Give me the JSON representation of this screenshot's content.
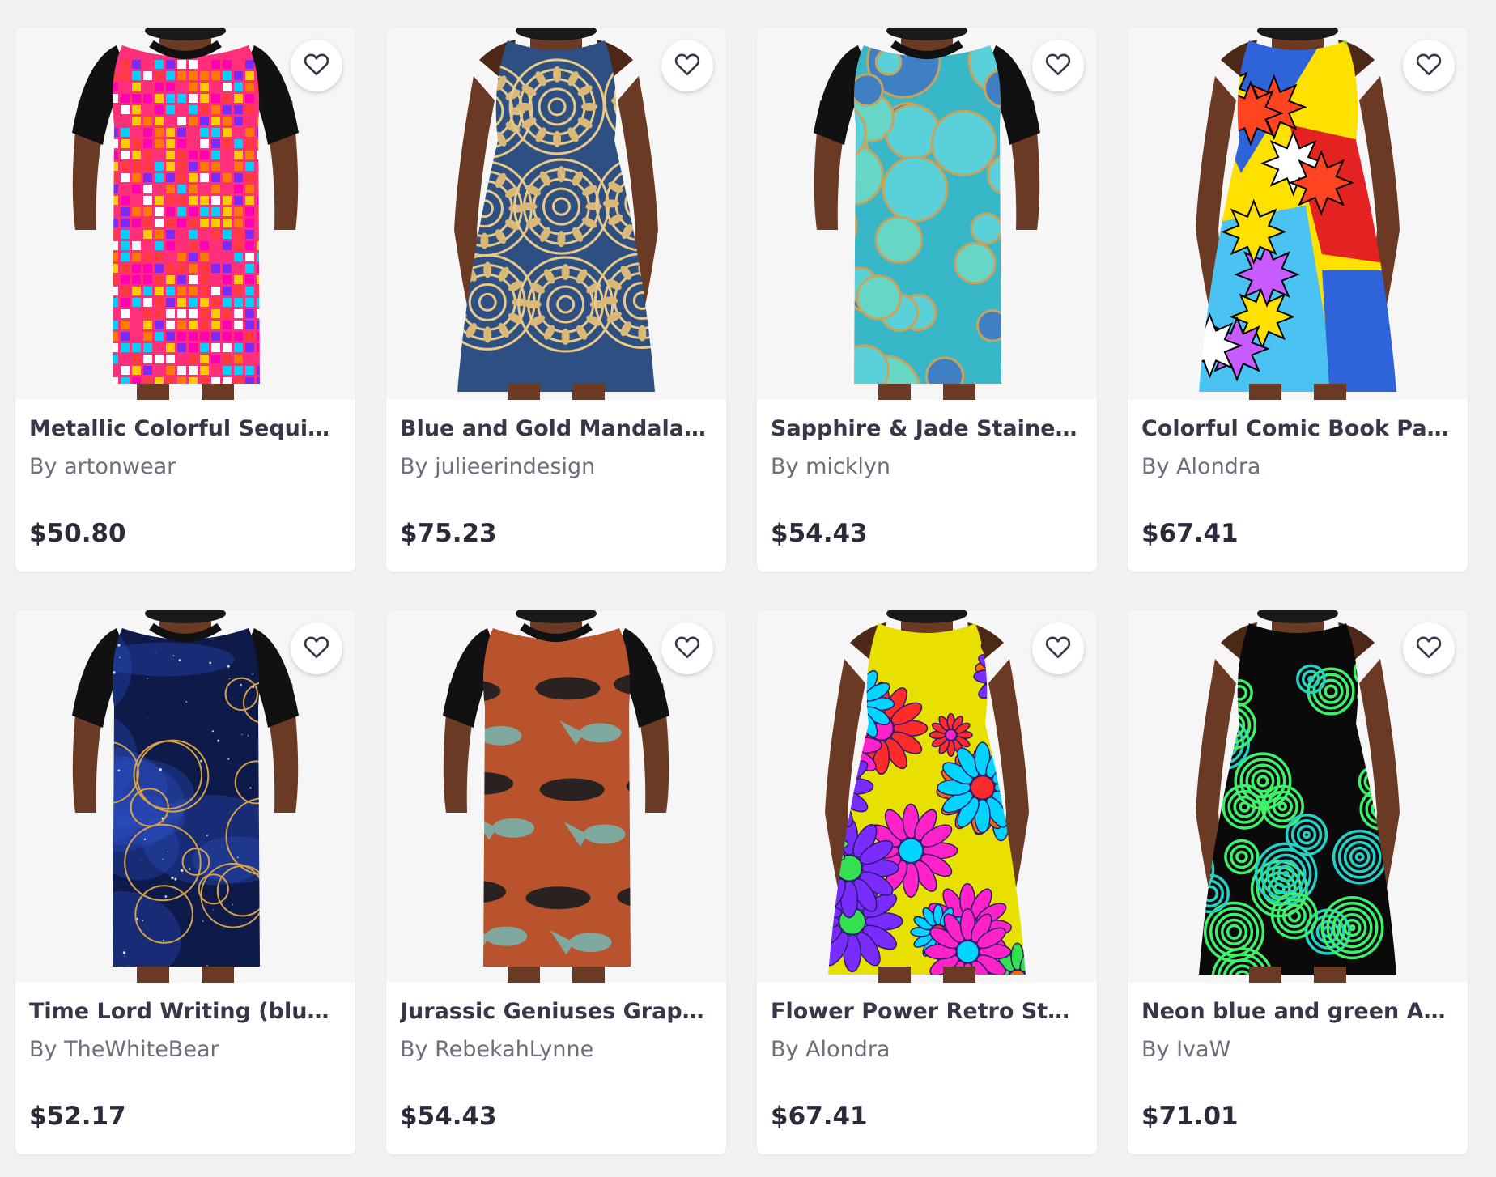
{
  "products": [
    {
      "title": "Metallic Colorful Sequins ...",
      "artist": "By artonwear",
      "price": "$50.80",
      "style": "tshirt",
      "pattern": "sequins",
      "colors": {
        "base": "#ff2f7a",
        "a": "#ffcc00",
        "b": "#7a2cff",
        "c": "#00d0ff"
      }
    },
    {
      "title": "Blue and Gold Mandala P...",
      "artist": "By julieerindesign",
      "price": "$75.23",
      "style": "aline",
      "pattern": "mandala",
      "colors": {
        "base": "#2e4f82",
        "a": "#e8c98a",
        "b": "#d9b878",
        "c": "#1d3a66"
      }
    },
    {
      "title": "Sapphire & Jade Stained ...",
      "artist": "By micklyn",
      "price": "$54.43",
      "style": "tshirt",
      "pattern": "stained",
      "colors": {
        "base": "#38b7c9",
        "a": "#c9a35a",
        "b": "#5ad0d8",
        "c": "#3f7fc4"
      }
    },
    {
      "title": "Colorful Comic Book Pan...",
      "artist": "By Alondra",
      "price": "$67.41",
      "style": "aline",
      "pattern": "comic",
      "colors": {
        "base": "#ffe100",
        "a": "#e52222",
        "b": "#2e63d9",
        "c": "#4bc3f2"
      }
    },
    {
      "title": "Time Lord Writing (blue) ...",
      "artist": "By TheWhiteBear",
      "price": "$52.17",
      "style": "tshirt",
      "pattern": "galaxy",
      "colors": {
        "base": "#0d1a4a",
        "a": "#d4a24a",
        "b": "#2a4ec2",
        "c": "#14275e"
      }
    },
    {
      "title": "Jurassic Geniuses Graphi...",
      "artist": "By RebekahLynne",
      "price": "$54.43",
      "style": "tshirt",
      "pattern": "dino",
      "colors": {
        "base": "#b9532d",
        "a": "#7fa99f",
        "b": "#2a2220",
        "c": "#d98a5a"
      }
    },
    {
      "title": "Flower Power Retro Style...",
      "artist": "By Alondra",
      "price": "$67.41",
      "style": "aline",
      "pattern": "flowers",
      "colors": {
        "base": "#e8e100",
        "a": "#ff6a00",
        "b": "#ff22c8",
        "c": "#7a2cff"
      }
    },
    {
      "title": "Neon blue and green A-L...",
      "artist": "By IvaW",
      "price": "$71.01",
      "style": "aline",
      "pattern": "circles",
      "colors": {
        "base": "#0a0a0a",
        "a": "#3ef06a",
        "b": "#25d1c7",
        "c": "#1b9c3e"
      }
    }
  ],
  "icons": {
    "favorite": "heart-outline-icon"
  }
}
